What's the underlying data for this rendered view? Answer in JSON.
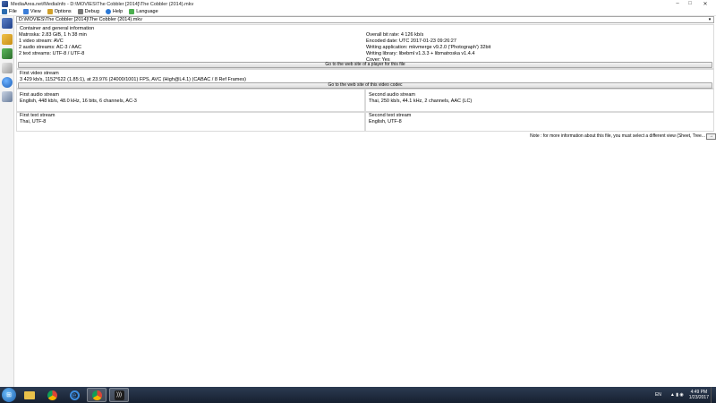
{
  "window": {
    "title": "MediaArea.net/MediaInfo - D:\\MOVIES\\The Cobbler [2014]\\The Cobbler (2014).mkv",
    "controls": [
      "–",
      "□",
      "✕"
    ]
  },
  "menu": [
    {
      "label": "File",
      "icon": "file-icon",
      "color": "#2b6cb0"
    },
    {
      "label": "View",
      "icon": "view-icon",
      "color": "#3b7dd8"
    },
    {
      "label": "Options",
      "icon": "options-icon",
      "color": "#d1a12d"
    },
    {
      "label": "Debug",
      "icon": "debug-icon",
      "color": "#7a7a7a"
    },
    {
      "label": "Help",
      "icon": "help-icon",
      "color": "#2a78d6"
    },
    {
      "label": "Language",
      "icon": "language-icon",
      "color": "#4caf50"
    }
  ],
  "sidebar_icons": [
    "open-file-icon",
    "open-folder-icon",
    "export-icon",
    "sheet-icon",
    "about-icon",
    "preferences-icon"
  ],
  "file_path": "D:\\MOVIES\\The Cobbler [2014]\\The Cobbler (2014).mkv",
  "general": {
    "title": "Container and general information",
    "left": [
      "Matroska: 2.83 GiB, 1 h 38 min",
      "1 video stream: AVC",
      "2 audio streams: AC-3 / AAC",
      "2 text streams: UTF-8 / UTF-8"
    ],
    "right": [
      "Overall bit rate: 4 126 kb/s",
      "Encoded date: UTC 2017-01-23 09:26:27",
      "Writing application: mkvmerge v9.2.0 ('Photograph') 32bit",
      "Writing library: libebml v1.3.3 + libmatroska v1.4.4",
      "Cover: Yes"
    ],
    "button": "Go to the web site of a player for this file"
  },
  "video": {
    "title": "First video stream",
    "line": "3 429 kb/s, 1152*622 (1.85:1), at 23.976 (24000/1001) FPS, AVC (High@L4.1) (CABAC / 8 Ref Frames)",
    "button": "Go to the web site of this video codec"
  },
  "audio": [
    {
      "title": "First audio stream",
      "line": "English, 448 kb/s, 48.0 kHz, 16 bits, 6 channels, AC-3"
    },
    {
      "title": "Second audio stream",
      "line": "Thai, 250 kb/s, 44.1 kHz, 2 channels, AAC (LC)"
    }
  ],
  "text": [
    {
      "title": "First text stream",
      "line": "Thai, UTF-8"
    },
    {
      "title": "Second text stream",
      "line": "English, UTF-8"
    }
  ],
  "note": "Note : for more information about this file, you must select a different view (Sheet, Tree...",
  "note_button": "→",
  "taskbar": {
    "apps": [
      "explorer-icon",
      "chrome-icon",
      "ie-icon",
      "chrome-icon",
      "mediainfo-icon"
    ],
    "language": "EN",
    "time": "4:49 PM",
    "date": "1/23/2017"
  }
}
